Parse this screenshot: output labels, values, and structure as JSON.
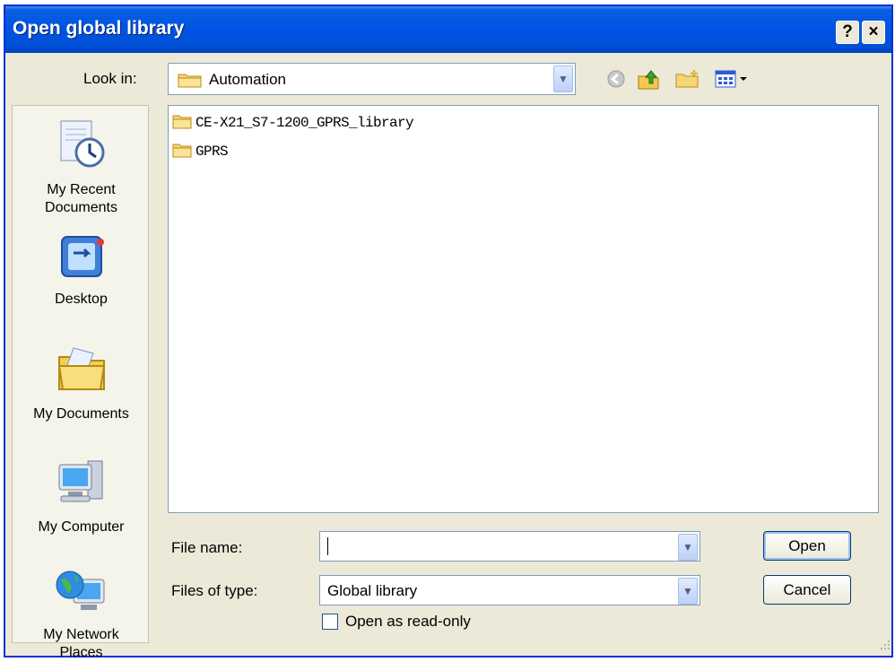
{
  "window": {
    "title": "Open global library",
    "help_label": "?",
    "close_label": "×"
  },
  "lookin": {
    "label": "Look in:",
    "value": "Automation"
  },
  "toolbar": {
    "icons": [
      "back-icon",
      "up-folder-icon",
      "new-folder-icon",
      "views-menu-icon"
    ]
  },
  "places": {
    "items": [
      {
        "label": "My Recent Documents",
        "line1": "My Recent",
        "line2": "Documents",
        "icon": "recent-documents-icon"
      },
      {
        "label": "Desktop",
        "icon": "desktop-icon"
      },
      {
        "label": "My Documents",
        "icon": "my-documents-icon"
      },
      {
        "label": "My Computer",
        "icon": "my-computer-icon"
      },
      {
        "label": "My Network Places",
        "line1": "My Network",
        "line2": "Places",
        "icon": "network-places-icon"
      }
    ]
  },
  "files": {
    "items": [
      {
        "name": "CE-X21_S7-1200_GPRS_library",
        "icon": "folder-icon"
      },
      {
        "name": "GPRS",
        "icon": "folder-icon"
      }
    ]
  },
  "filename": {
    "label": "File name:",
    "value": ""
  },
  "filetype": {
    "label": "Files of type:",
    "value": "Global library"
  },
  "readonly": {
    "label": "Open as read-only",
    "checked": false
  },
  "buttons": {
    "open": "Open",
    "cancel": "Cancel"
  }
}
